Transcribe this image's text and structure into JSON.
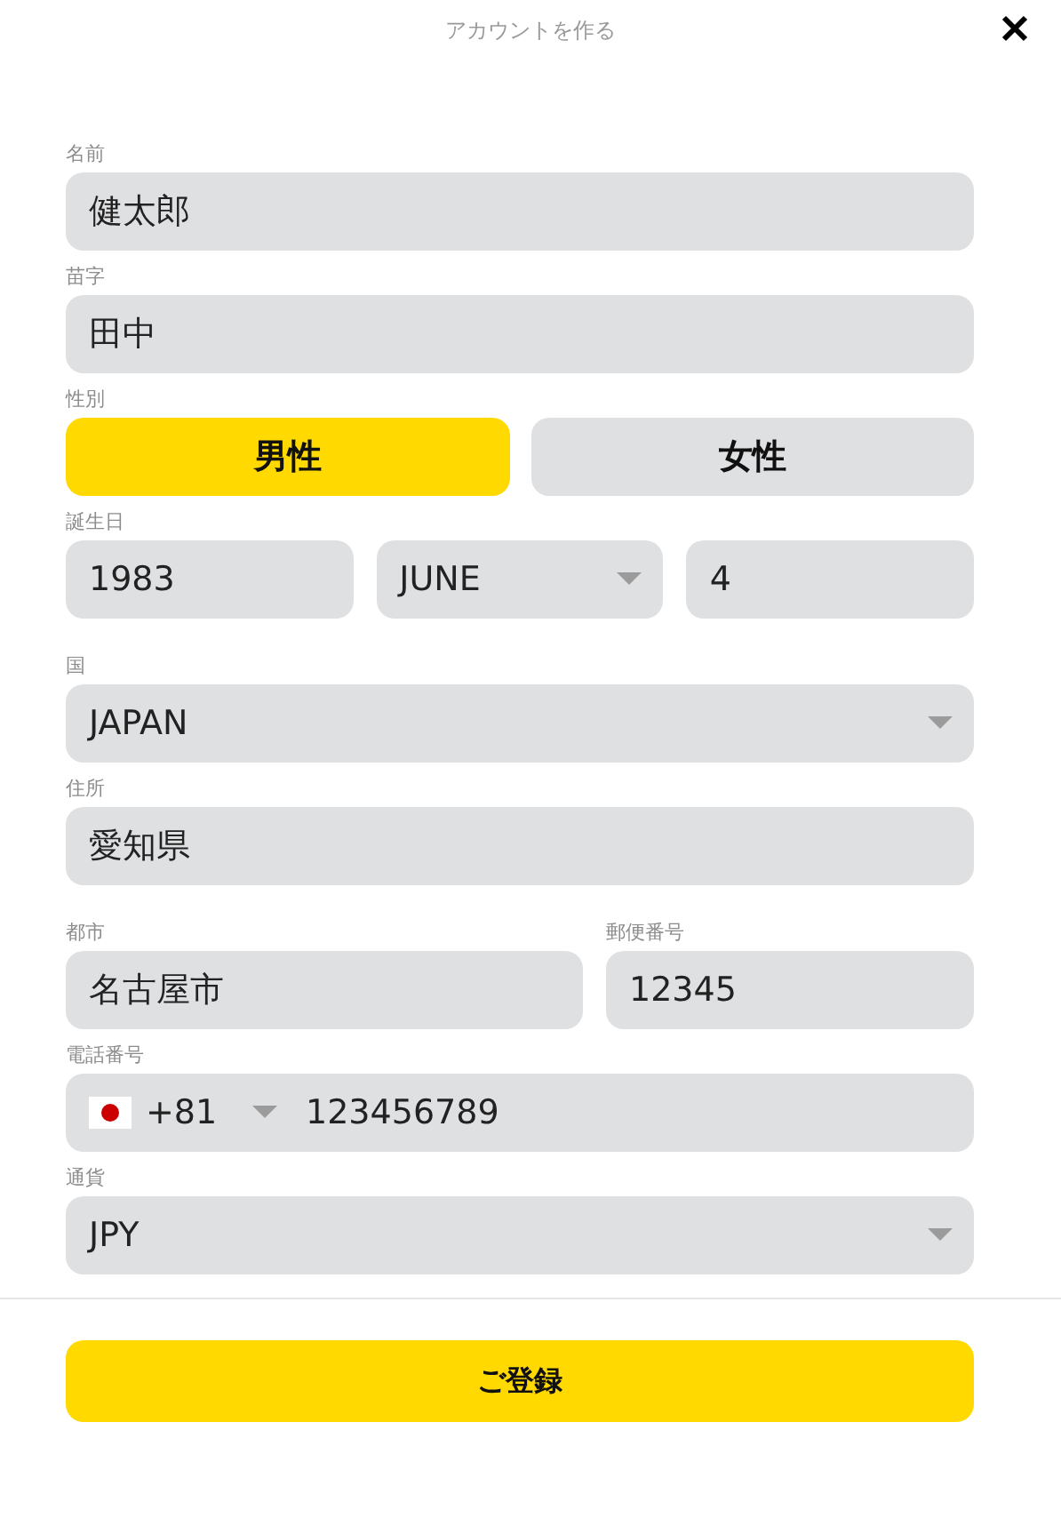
{
  "title": "アカウントを作る",
  "rows": [
    {
      "fields": [
        {
          "kind": "text",
          "label": "名前",
          "value": "健太郎"
        }
      ]
    },
    {
      "fields": [
        {
          "kind": "text",
          "label": "苗字",
          "value": "田中"
        }
      ]
    },
    {
      "fields": [
        {
          "kind": "choice",
          "label": "性別",
          "options": [
            {
              "label": "男性",
              "selected": true
            },
            {
              "label": "女性",
              "selected": false
            }
          ]
        }
      ]
    },
    {
      "label": "誕生日",
      "fields": [
        {
          "kind": "text",
          "value": "1983"
        },
        {
          "kind": "select",
          "value": "JUNE"
        },
        {
          "kind": "text",
          "value": "4"
        }
      ]
    },
    {
      "fields": [
        {
          "kind": "select",
          "label": "国",
          "value": "JAPAN"
        }
      ]
    },
    {
      "fields": [
        {
          "kind": "text",
          "label": "住所",
          "value": "愛知県"
        }
      ]
    },
    {
      "fields": [
        {
          "kind": "text",
          "label": "都市",
          "value": "名古屋市"
        },
        {
          "kind": "text",
          "label": "郵便番号",
          "value": "12345"
        }
      ]
    },
    {
      "fields": [
        {
          "kind": "phone",
          "label": "電話番号",
          "code": "+81",
          "value": "123456789"
        }
      ]
    },
    {
      "fields": [
        {
          "kind": "select",
          "label": "通貨",
          "value": "JPY"
        }
      ]
    }
  ],
  "submit": "ご登録"
}
